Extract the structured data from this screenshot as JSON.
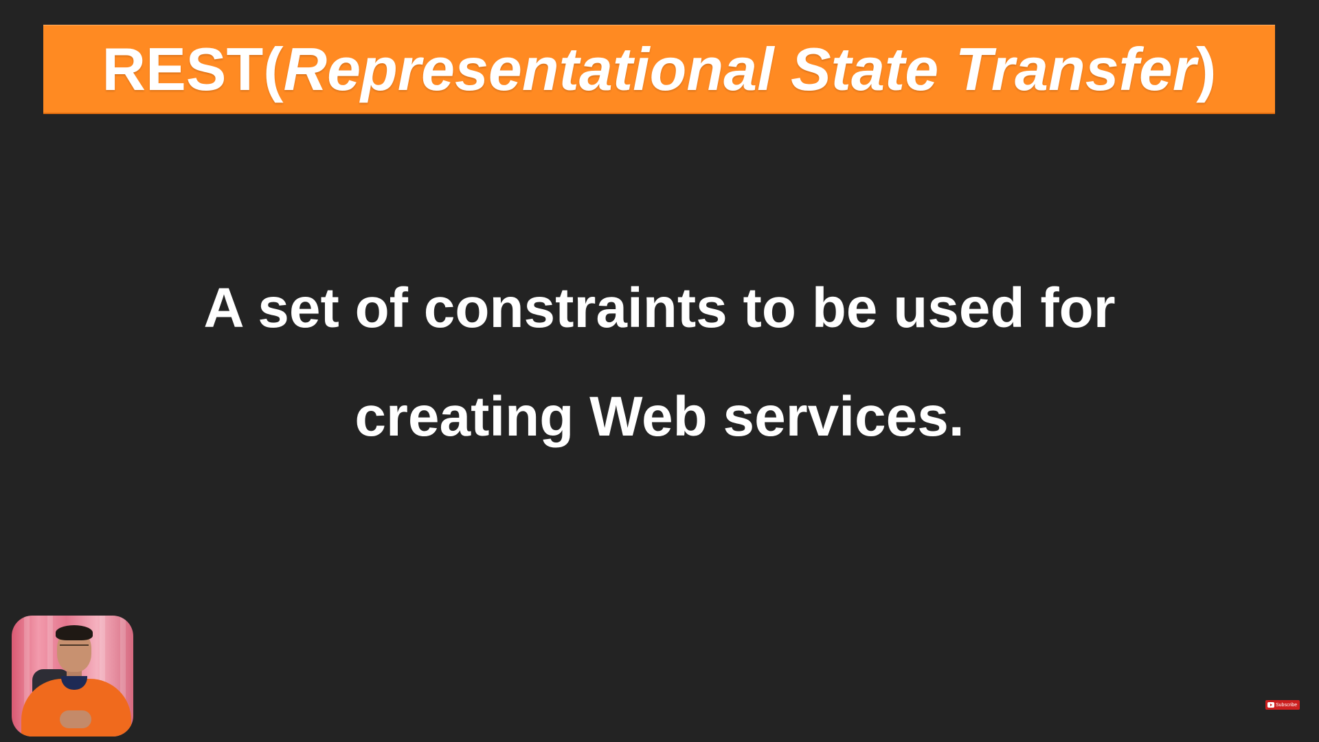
{
  "slide": {
    "title": {
      "prefix": "REST(",
      "expansion": "Representational State Transfer",
      "suffix": ")"
    },
    "body": {
      "line1": "A set of constraints to be used for",
      "line2": "creating Web services."
    }
  },
  "overlay": {
    "subscribe_label": "Subscribe"
  },
  "colors": {
    "background": "#232323",
    "banner": "#ff8a22",
    "text": "#ffffff",
    "subscribe": "#cc1f1f"
  },
  "icons": {
    "presenter": "presenter-webcam",
    "subscribe": "youtube-play-icon"
  }
}
